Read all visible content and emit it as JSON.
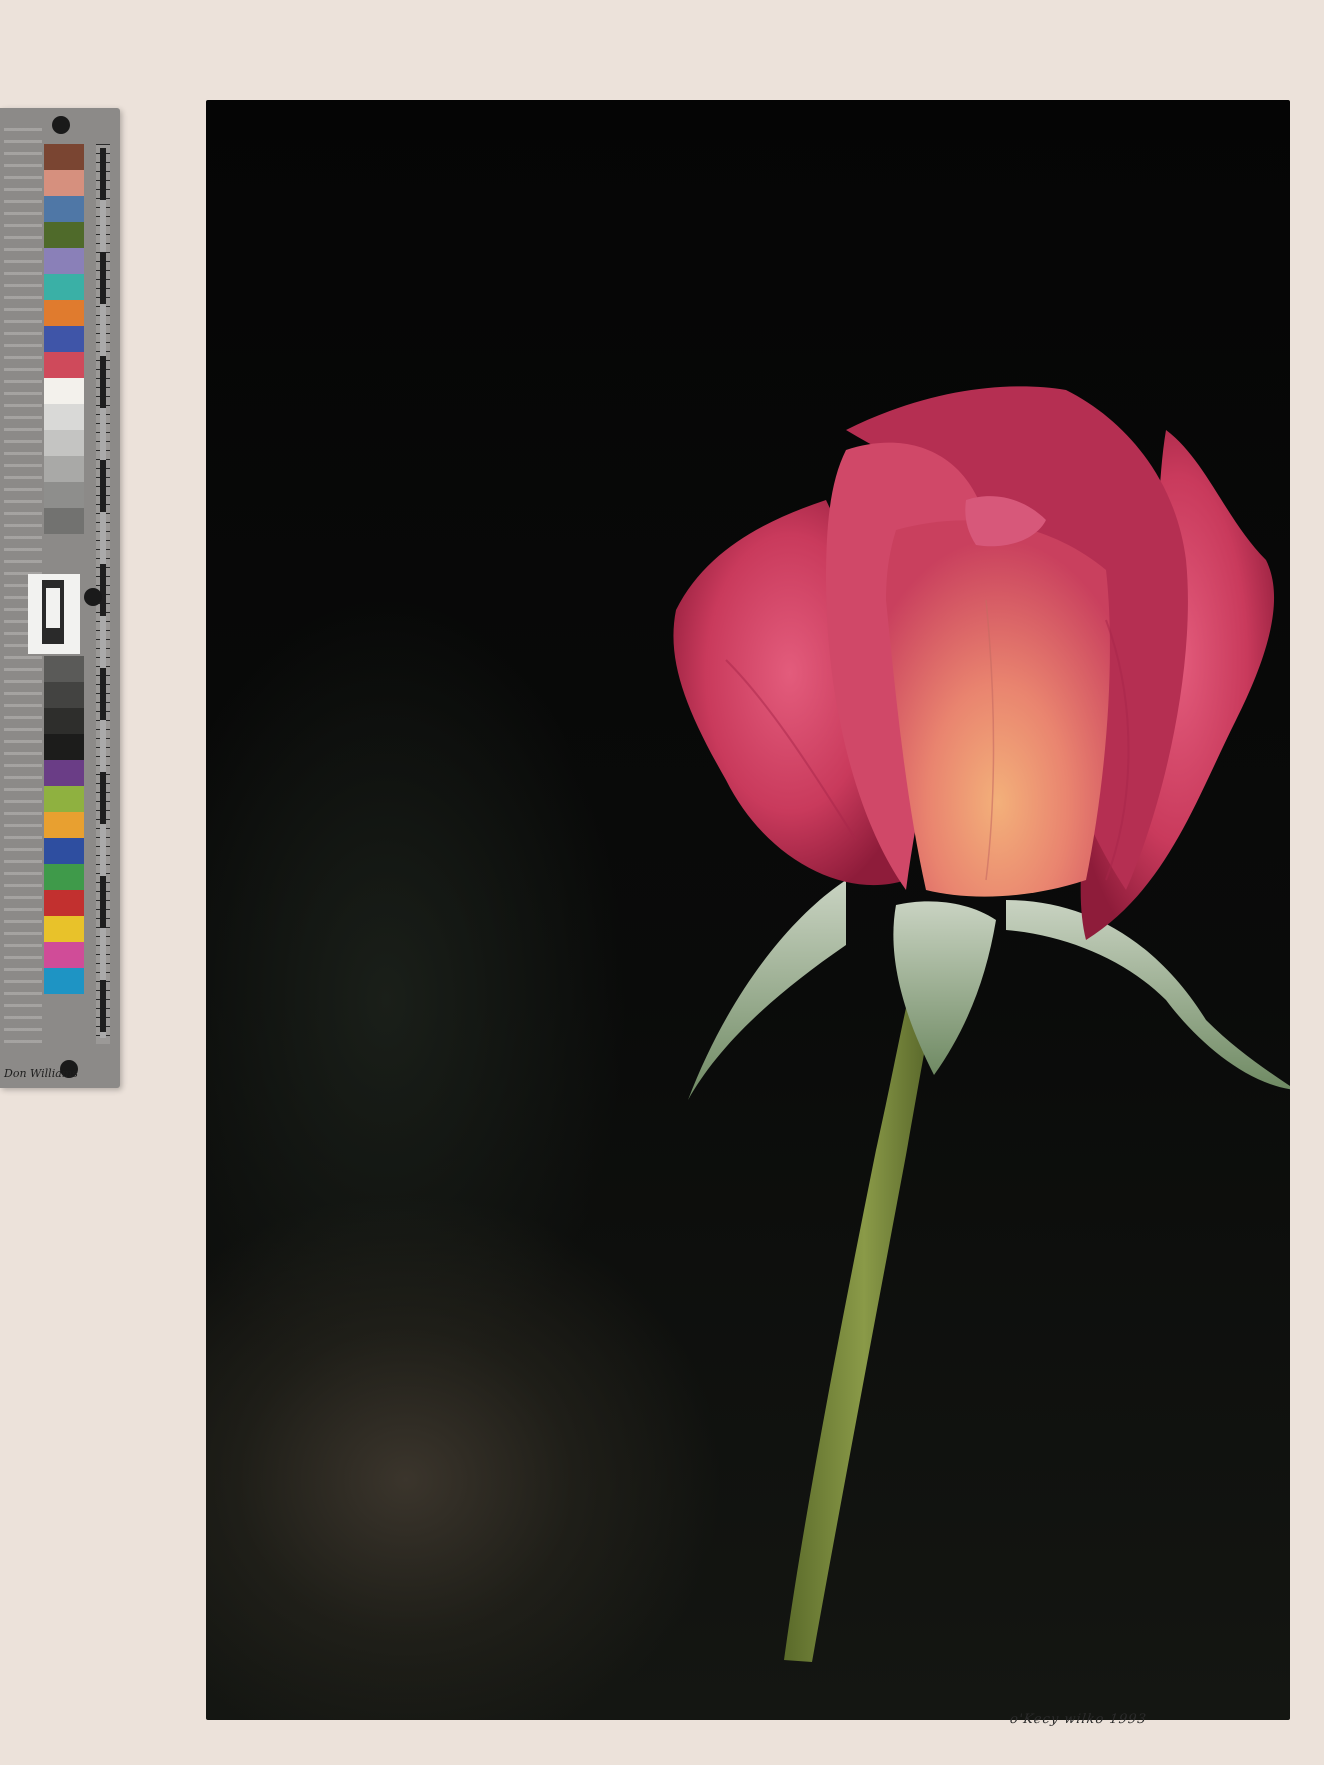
{
  "color_target": {
    "brand": "Don Williams",
    "swatches": [
      "#7a4532",
      "#d6907e",
      "#4f77a6",
      "#4f6a2a",
      "#8a80b8",
      "#3ab0a6",
      "#e07b2e",
      "#3f55a8",
      "#cf4a5b",
      "#f3f1ec",
      "#d9d9d7",
      "#c4c4c2",
      "#a9a9a7",
      "#8e8e8c",
      "#727270",
      "#5a5a58",
      "#434341",
      "#2e2e2c",
      "#1c1c1b",
      "#6a3d86",
      "#8fb140",
      "#e8a030",
      "#2e4ea0",
      "#3f9a4a",
      "#c2302f",
      "#e8c22a",
      "#d04c98",
      "#1e94c4"
    ]
  },
  "photo": {
    "signature": "o'Kecy wilko 1993"
  }
}
